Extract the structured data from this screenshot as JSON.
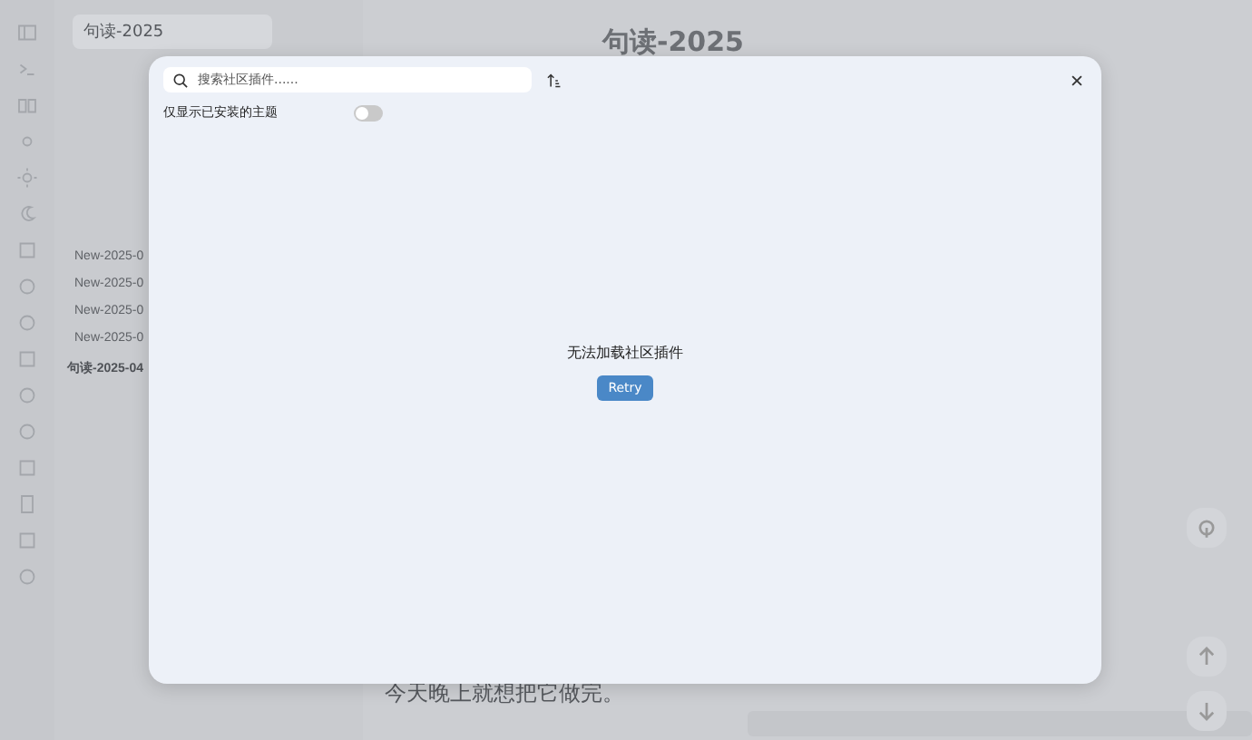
{
  "app": {
    "tab_title": "句读-2025",
    "note_title": "句读-2025",
    "file_list": [
      {
        "label": "New-2025-0",
        "kind": "file"
      },
      {
        "label": "New-2025-0",
        "kind": "file"
      },
      {
        "label": "New-2025-0",
        "kind": "file"
      },
      {
        "label": "New-2025-0",
        "kind": "file"
      },
      {
        "label": "句读-2025-04",
        "kind": "heading"
      }
    ],
    "body_line": "今天晚上就想把它做完。"
  },
  "modal": {
    "search": {
      "placeholder": "搜索社区插件......"
    },
    "filter": {
      "label": "仅显示已安装的主题",
      "on": false
    },
    "message": "无法加载社区插件",
    "retry": "Retry"
  }
}
